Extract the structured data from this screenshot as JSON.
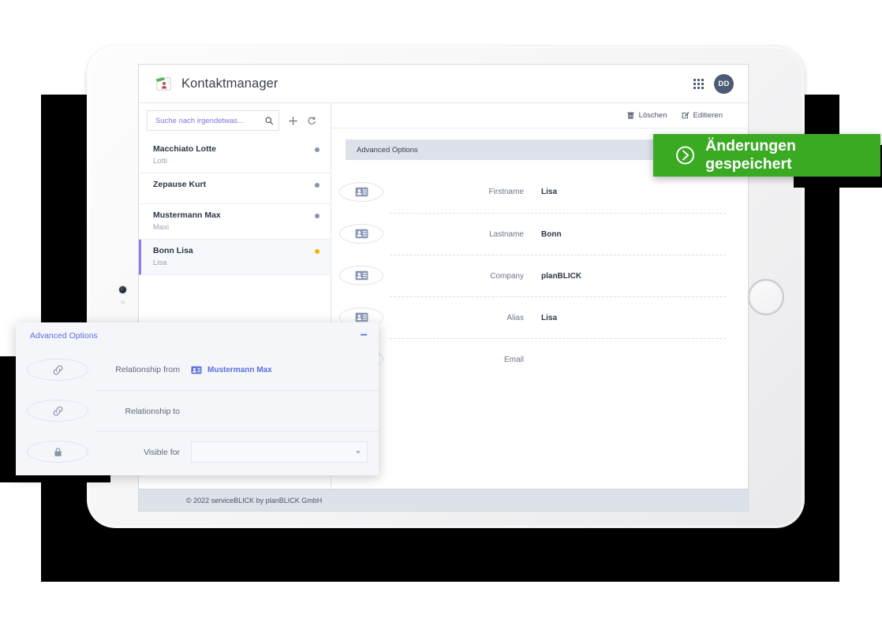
{
  "app": {
    "title": "Kontaktmanager",
    "logo_icon": "contact-card-logo",
    "apps_grid_icon": "apps-grid-icon",
    "avatar_initials": "DD"
  },
  "search": {
    "placeholder": "Suche nach irgendetwas...",
    "value": "",
    "search_icon": "search-icon",
    "add_icon": "add-move-icon",
    "refresh_icon": "refresh-icon"
  },
  "contacts": [
    {
      "name": "Macchiato Lotte",
      "alias": "Lotti",
      "status": "idle",
      "selected": false
    },
    {
      "name": "Zepause Kurt",
      "alias": "",
      "status": "idle",
      "selected": false
    },
    {
      "name": "Mustermann Max",
      "alias": "Maxi",
      "status": "idle",
      "selected": false
    },
    {
      "name": "Bonn Lisa",
      "alias": "Lisa",
      "status": "active",
      "selected": true
    }
  ],
  "detail": {
    "actions": [
      {
        "label": "Löschen",
        "icon": "trash-icon"
      },
      {
        "label": "Editieren",
        "icon": "edit-pencil-icon"
      }
    ],
    "advanced_bar_label": "Advanced Options",
    "fields": [
      {
        "label": "Firstname",
        "value": "Lisa",
        "icon": "contact-card-icon"
      },
      {
        "label": "Lastname",
        "value": "Bonn",
        "icon": "contact-card-icon"
      },
      {
        "label": "Company",
        "value": "planBLICK",
        "icon": "contact-card-icon"
      },
      {
        "label": "Alias",
        "value": "Lisa",
        "icon": "contact-card-icon"
      },
      {
        "label": "Email",
        "value": "",
        "icon": "contact-card-icon"
      }
    ]
  },
  "footer": {
    "text": "© 2022 serviceBLICK by planBLICK GmbH"
  },
  "toast": {
    "message": "Änderungen gespeichert",
    "icon": "circle-arrow-icon",
    "color": "#3aaa23"
  },
  "advanced_overlay": {
    "title": "Advanced Options",
    "minimize_label": "−",
    "rows": [
      {
        "label": "Relationship from",
        "value": "Mustermann Max",
        "icon": "link-icon",
        "value_icon": "contact-card-icon",
        "type": "chip"
      },
      {
        "label": "Relationship to",
        "value": "",
        "icon": "link-icon",
        "value_icon": "",
        "type": "chip"
      },
      {
        "label": "Visible for",
        "value": "",
        "icon": "lock-icon",
        "value_icon": "",
        "type": "select"
      }
    ]
  },
  "colors": {
    "accent_purple": "#5b6fe0",
    "status_active": "#f7b500",
    "status_idle": "#8793ad",
    "toast_green": "#3aaa23",
    "panel_gray": "#dde1ea"
  }
}
